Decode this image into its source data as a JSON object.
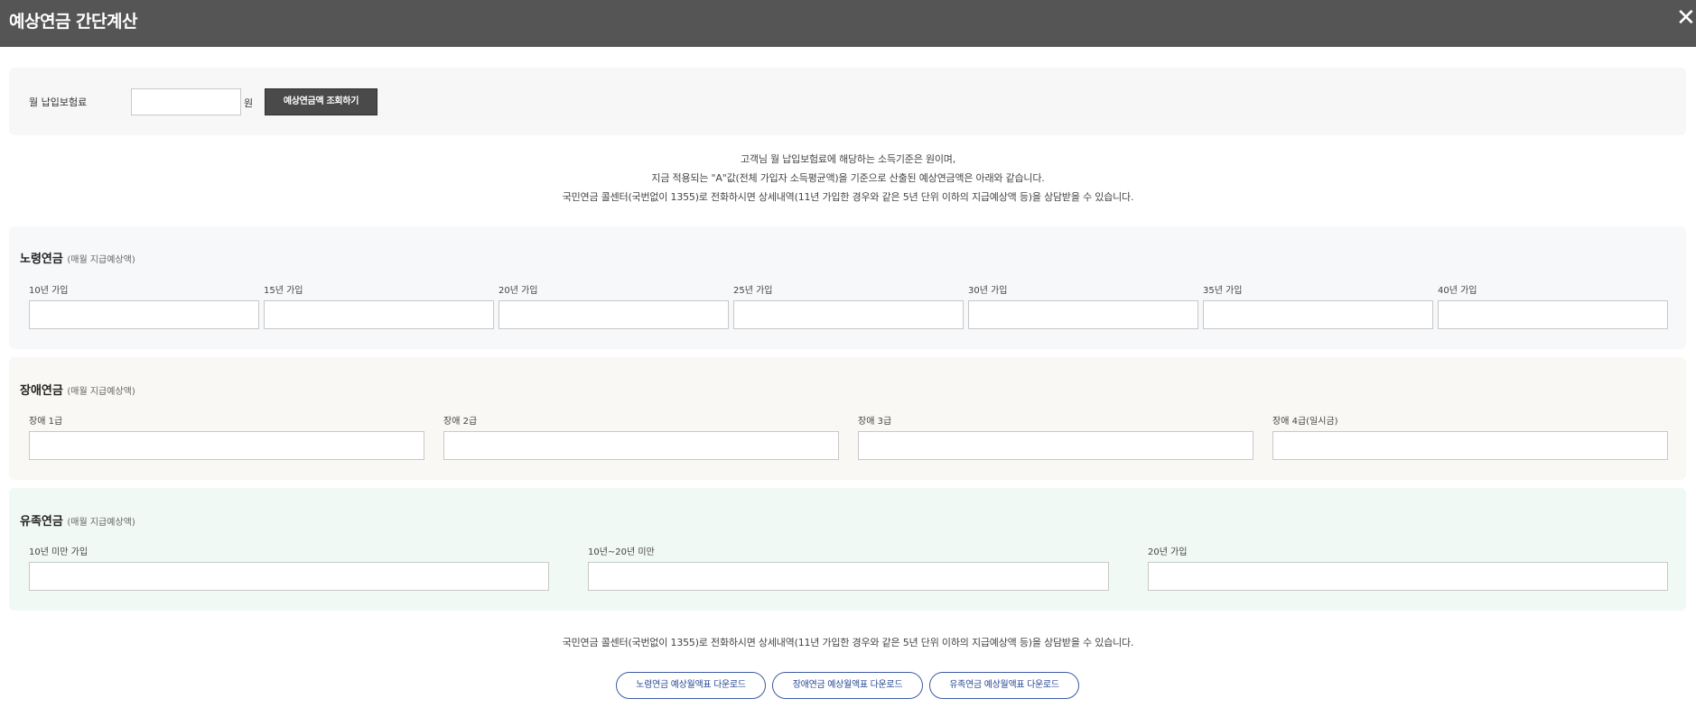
{
  "header": {
    "title": "예상연금 간단계산",
    "close_label": "✕"
  },
  "input_panel": {
    "label": "월 납입보험료",
    "input_value": "",
    "unit": "원",
    "query_button": "예상연금액 조회하기"
  },
  "info_lines": [
    "고객님 월 납입보험료에 해당하는 소득기준은 원이며,",
    "지금 적용되는 \"A\"값(전체 가입자 소득평균액)을 기준으로 산출된 예상연금액은 아래와 같습니다.",
    "국민연금 콜센터(국번없이 1355)로 전화하시면 상세내역(11년 가입한 경우와 같은 5년 단위 이하의 지급예상액 등)을 상담받을 수 있습니다."
  ],
  "old_age": {
    "title": "노령연금",
    "subtitle": "(매월 지급예상액)",
    "fields": [
      "10년 가입",
      "15년 가입",
      "20년 가입",
      "25년 가입",
      "30년 가입",
      "35년 가입",
      "40년 가입"
    ]
  },
  "disability": {
    "title": "장애연금",
    "subtitle": "(매월 지급예상액)",
    "fields": [
      "장애 1급",
      "장애 2급",
      "장애 3급",
      "장애 4급(일시금)"
    ]
  },
  "survivor": {
    "title": "유족연금",
    "subtitle": "(매월 지급예상액)",
    "fields": [
      "10년 미만 가입",
      "10년~20년 미만",
      "20년 가입"
    ]
  },
  "bottom_info": "국민연금 콜센터(국번없이 1355)로 전화하시면 상세내역(11년 가입한 경우와 같은 5년 단위 이하의 지급예상액 등)을 상담받을 수 있습니다.",
  "downloads": [
    "노령연금 예상월액표 다운로드",
    "장애연금 예상월액표 다운로드",
    "유족연금 예상월액표 다운로드"
  ]
}
